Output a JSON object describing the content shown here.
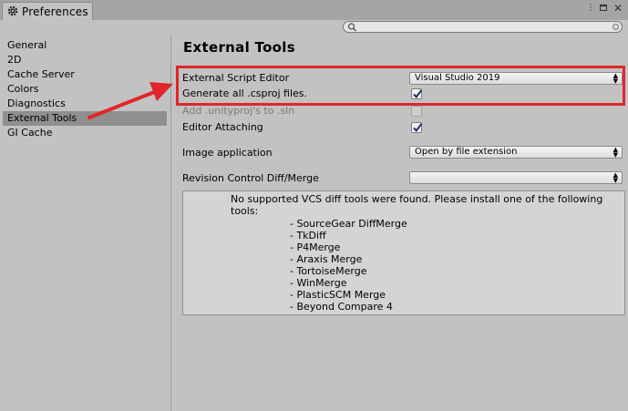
{
  "window": {
    "title": "Preferences"
  },
  "sidebar": {
    "items": [
      {
        "label": "General"
      },
      {
        "label": "2D"
      },
      {
        "label": "Cache Server"
      },
      {
        "label": "Colors"
      },
      {
        "label": "Diagnostics"
      },
      {
        "label": "External Tools",
        "selected": true
      },
      {
        "label": "GI Cache"
      }
    ]
  },
  "main": {
    "title": "External Tools",
    "external_script_editor": {
      "label": "External Script Editor",
      "value": "Visual Studio 2019"
    },
    "generate_csproj": {
      "label": "Generate all .csproj files.",
      "checked": true
    },
    "add_unityproj": {
      "label": "Add .unityproj's to .sln",
      "checked": false,
      "disabled": true
    },
    "editor_attaching": {
      "label": "Editor Attaching",
      "checked": true
    },
    "image_application": {
      "label": "Image application",
      "value": "Open by file extension"
    },
    "revision_control": {
      "label": "Revision Control Diff/Merge",
      "value": ""
    },
    "vcs_help": {
      "message": "No supported VCS diff tools were found. Please install one of the following tools:",
      "tools": [
        "- SourceGear DiffMerge",
        "- TkDiff",
        "- P4Merge",
        "- Araxis Merge",
        "- TortoiseMerge",
        "- WinMerge",
        "- PlasticSCM Merge",
        "- Beyond Compare 4"
      ]
    }
  },
  "colors": {
    "annotation": "#e0262a",
    "selection": "#8f8f8f",
    "panel": "#c2c2c2"
  },
  "icons": [
    "gear-icon",
    "kebab-menu-icon",
    "maximize-icon",
    "close-icon",
    "search-icon",
    "search-clear-icon",
    "checkmark-icon",
    "dropdown-arrow-icon"
  ]
}
